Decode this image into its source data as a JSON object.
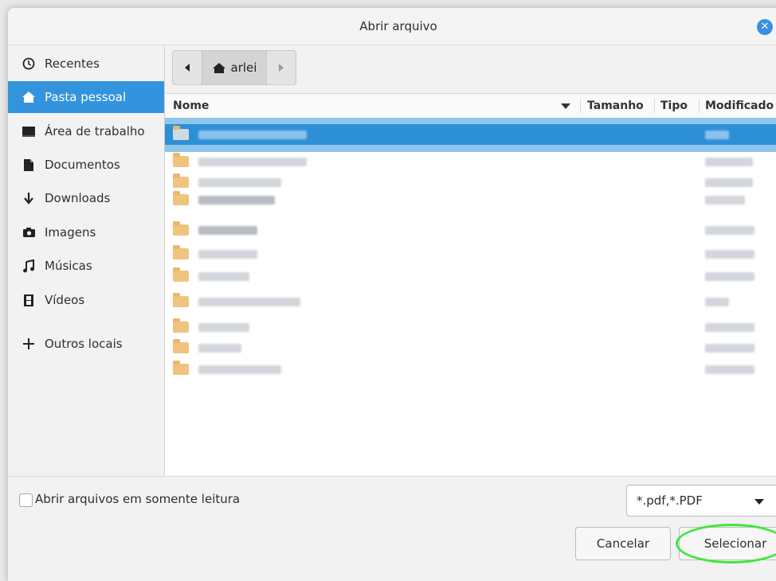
{
  "window": {
    "title": "Abrir arquivo",
    "close_icon": "close-icon"
  },
  "sidebar": {
    "items": [
      {
        "label": "Recentes",
        "icon": "clock-icon",
        "active": false
      },
      {
        "label": "Pasta pessoal",
        "icon": "home-icon",
        "active": true
      },
      {
        "label": "Área de trabalho",
        "icon": "desktop-icon",
        "active": false
      },
      {
        "label": "Documentos",
        "icon": "document-icon",
        "active": false
      },
      {
        "label": "Downloads",
        "icon": "download-icon",
        "active": false
      },
      {
        "label": "Imagens",
        "icon": "camera-icon",
        "active": false
      },
      {
        "label": "Músicas",
        "icon": "music-icon",
        "active": false
      },
      {
        "label": "Vídeos",
        "icon": "film-icon",
        "active": false
      },
      {
        "label": "Outros locais",
        "icon": "plus-icon",
        "active": false
      }
    ]
  },
  "pathbar": {
    "current": "arlei"
  },
  "columns": {
    "name": "Nome",
    "size": "Tamanho",
    "type": "Tipo",
    "modified": "Modificado"
  },
  "footer": {
    "readonly_label": "Abrir arquivos em somente leitura",
    "filter_value": "*.pdf,*.PDF",
    "cancel_label": "Cancelar",
    "select_label": "Selecionar"
  },
  "colors": {
    "accent": "#3493dd",
    "highlight_ring": "#3ee83a"
  }
}
